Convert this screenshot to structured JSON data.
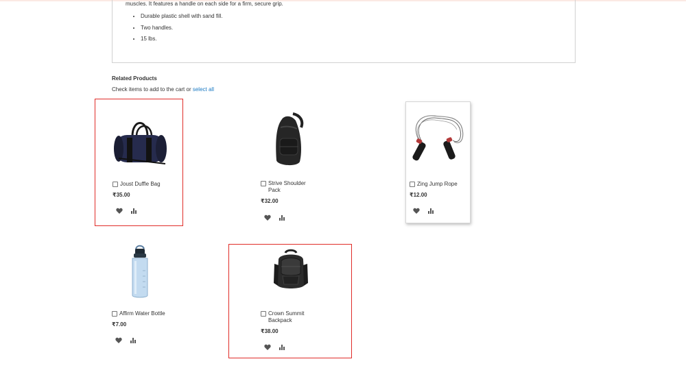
{
  "description": {
    "intro_tail": "muscles. It features a handle on each side for a firm, secure grip.",
    "bullets": [
      "Durable plastic shell with sand fill.",
      "Two handles.",
      "15 lbs."
    ]
  },
  "related": {
    "title": "Related Products",
    "instruction": "Check items to add to the cart or",
    "select_all": "select all",
    "products": [
      {
        "name": "Joust Duffle Bag",
        "price": "₹35.00",
        "image": "duffle-bag"
      },
      {
        "name": "Strive Shoulder Pack",
        "price": "₹32.00",
        "image": "shoulder-pack"
      },
      {
        "name": "Zing Jump Rope",
        "price": "₹12.00",
        "image": "jump-rope"
      },
      {
        "name": "Affirm Water Bottle",
        "price": "₹7.00",
        "image": "water-bottle"
      },
      {
        "name": "Crown Summit Backpack",
        "price": "₹38.00",
        "image": "backpack"
      }
    ]
  },
  "icons": {
    "wishlist": "heart-icon",
    "compare": "compare-icon"
  },
  "colors": {
    "selection_border": "#e02b27",
    "link": "#1979c3"
  }
}
